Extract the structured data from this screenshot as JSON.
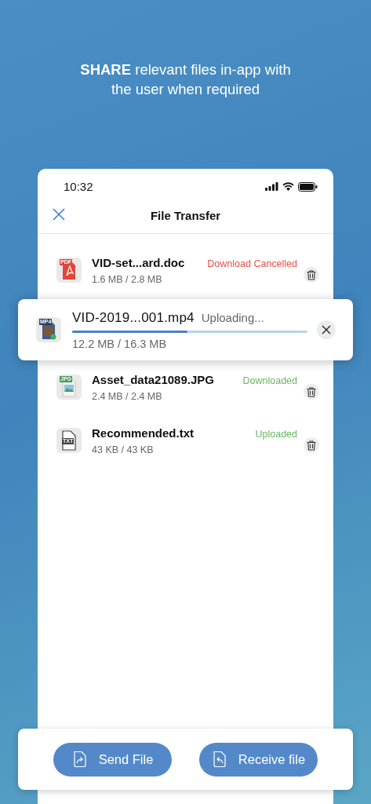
{
  "headline": "**SHARE** relevant files in-app with the user when required",
  "status_bar": {
    "time": "10:32"
  },
  "header": {
    "title": "File Transfer"
  },
  "files": [
    {
      "name": "VID-set...ard.doc",
      "size": "1.6 MB / 2.8 MB",
      "status": "Download Cancelled",
      "kind": "cancelled",
      "icon_label": "PDF"
    },
    {
      "name": "VID-2019...001.mp4",
      "size": "12.2 MB / 16.3 MB",
      "status": "Uploading...",
      "kind": "active",
      "level": 0.49,
      "icon_label": "MP4"
    },
    {
      "name": "Asset_data21089.JPG",
      "size": "2.4 MB / 2.4 MB",
      "status": "Downloaded",
      "kind": "complete",
      "icon_label": "JPG"
    },
    {
      "name": "Recommended.txt",
      "size": "43 KB / 43 KB",
      "status": "Uploaded",
      "kind": "complete",
      "icon_label": "TXT"
    }
  ],
  "buttons": [
    {
      "label": "Send File",
      "kind": "send"
    },
    {
      "label": "Receive file",
      "kind": "receive"
    }
  ]
}
